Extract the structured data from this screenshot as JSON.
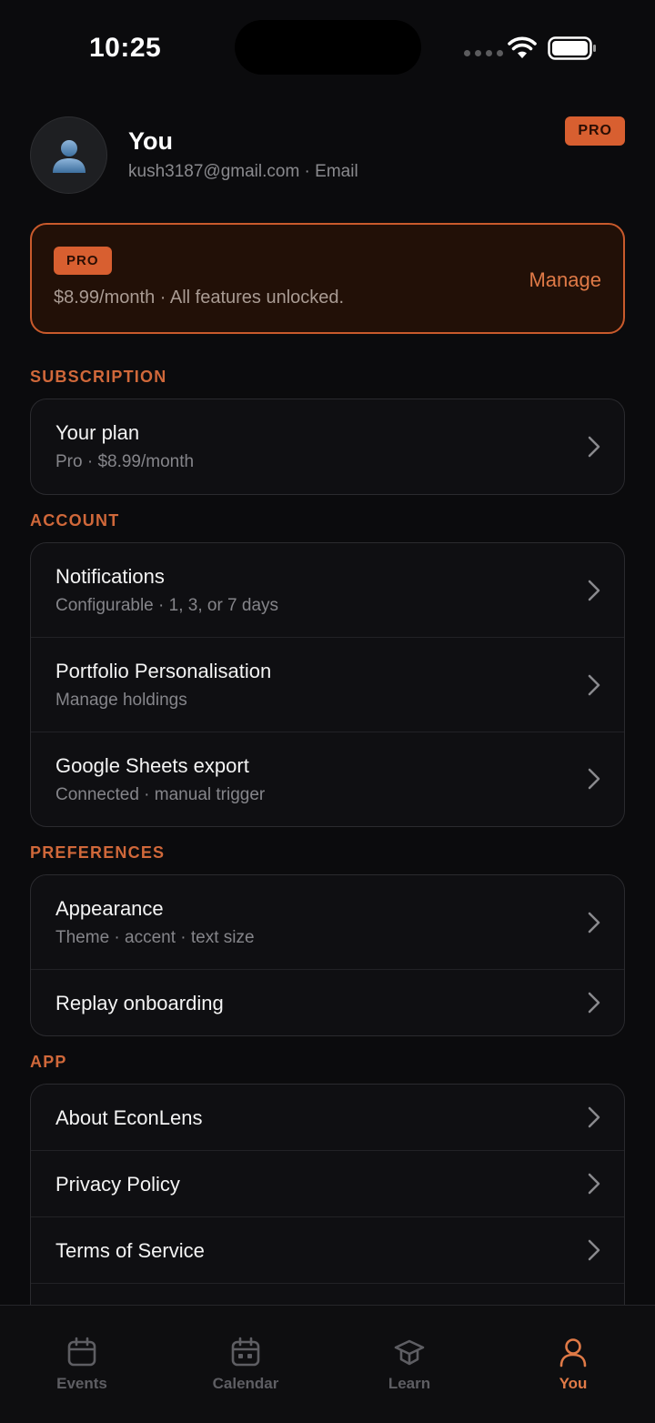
{
  "status_bar": {
    "time": "10:25"
  },
  "profile": {
    "name": "You",
    "email_line": "kush3187@gmail.com · Email",
    "badge": "PRO"
  },
  "pro_banner": {
    "badge": "PRO",
    "text": "$8.99/month · All features unlocked.",
    "action": "Manage"
  },
  "sections": {
    "subscription": {
      "label": "SUBSCRIPTION",
      "items": [
        {
          "title": "Your plan",
          "subtitle": "Pro · $8.99/month"
        }
      ]
    },
    "account": {
      "label": "ACCOUNT",
      "items": [
        {
          "title": "Notifications",
          "subtitle": "Configurable · 1, 3, or 7 days"
        },
        {
          "title": "Portfolio Personalisation",
          "subtitle": "Manage holdings"
        },
        {
          "title": "Google Sheets export",
          "subtitle": "Connected · manual trigger"
        }
      ]
    },
    "preferences": {
      "label": "PREFERENCES",
      "items": [
        {
          "title": "Appearance",
          "subtitle": "Theme · accent · text size"
        },
        {
          "title": "Replay onboarding"
        }
      ]
    },
    "app": {
      "label": "APP",
      "items": [
        {
          "title": "About EconLens"
        },
        {
          "title": "Privacy Policy"
        },
        {
          "title": "Terms of Service"
        }
      ]
    }
  },
  "tab_bar": {
    "tabs": [
      {
        "label": "Events",
        "icon": "calendar-icon"
      },
      {
        "label": "Calendar",
        "icon": "calendar-grid-icon"
      },
      {
        "label": "Learn",
        "icon": "graduation-cap-icon"
      },
      {
        "label": "You",
        "icon": "user-icon",
        "active": true
      }
    ]
  },
  "colors": {
    "accent": "#e07a47",
    "badge": "#d85f30",
    "background": "#0b0b0d"
  }
}
